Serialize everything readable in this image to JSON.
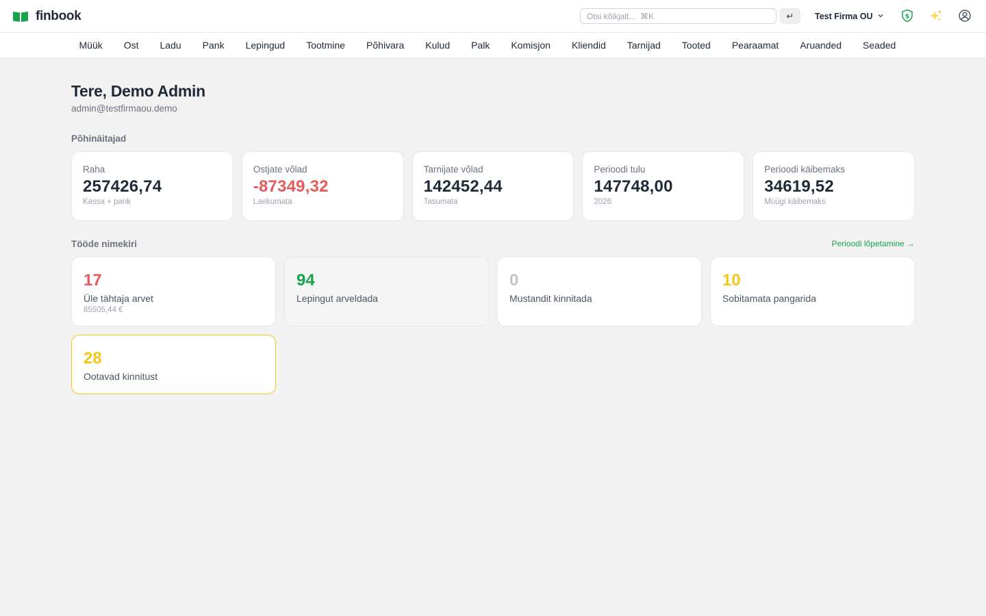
{
  "brand": {
    "name": "finbook",
    "accent": "#16a34a"
  },
  "header": {
    "search_placeholder": "Otsi kõikjalt...  ⌘K",
    "enter_glyph": "↵",
    "company": "Test Firma OU",
    "icons": [
      "shield-dollar-icon",
      "sparkles-icon",
      "user-circle-icon"
    ]
  },
  "nav": {
    "items": [
      "Müük",
      "Ost",
      "Ladu",
      "Pank",
      "Lepingud",
      "Tootmine",
      "Põhivara",
      "Kulud",
      "Palk",
      "Komisjon",
      "Kliendid",
      "Tarnijad",
      "Tooted",
      "Pearaamat",
      "Aruanded",
      "Seaded"
    ]
  },
  "main": {
    "greeting": "Tere, Demo Admin",
    "email": "admin@testfirmaou.demo",
    "kpi_title": "Põhinäitajad",
    "kpis": [
      {
        "label": "Raha",
        "value": "257426,74",
        "sub": "Kassa + pank",
        "negative": false
      },
      {
        "label": "Ostjate võlad",
        "value": "-87349,32",
        "sub": "Laekumata",
        "negative": true
      },
      {
        "label": "Tarnijate võlad",
        "value": "142452,44",
        "sub": "Tasumata",
        "negative": false
      },
      {
        "label": "Perioodi tulu",
        "value": "147748,00",
        "sub": "2026",
        "negative": false
      },
      {
        "label": "Perioodi käibemaks",
        "value": "34619,52",
        "sub": "Müügi käibemaks",
        "negative": false
      }
    ],
    "tasks_title": "Tööde nimekiri",
    "period_link": "Perioodi lõpetamine →",
    "tasks": [
      {
        "count": "17",
        "label": "Üle tähtaja arvet",
        "sub": "85505,44 €",
        "color": "#e85a5a",
        "style": "normal"
      },
      {
        "count": "94",
        "label": "Lepingut arveldada",
        "sub": "",
        "color": "#16a34a",
        "style": "muted"
      },
      {
        "count": "0",
        "label": "Mustandit kinnitada",
        "sub": "",
        "color": "#c4c4c4",
        "style": "normal"
      },
      {
        "count": "10",
        "label": "Sobitamata pangarida",
        "sub": "",
        "color": "#f5c518",
        "style": "normal"
      },
      {
        "count": "28",
        "label": "Ootavad kinnitust",
        "sub": "",
        "color": "#f5c518",
        "style": "highlight"
      }
    ]
  }
}
